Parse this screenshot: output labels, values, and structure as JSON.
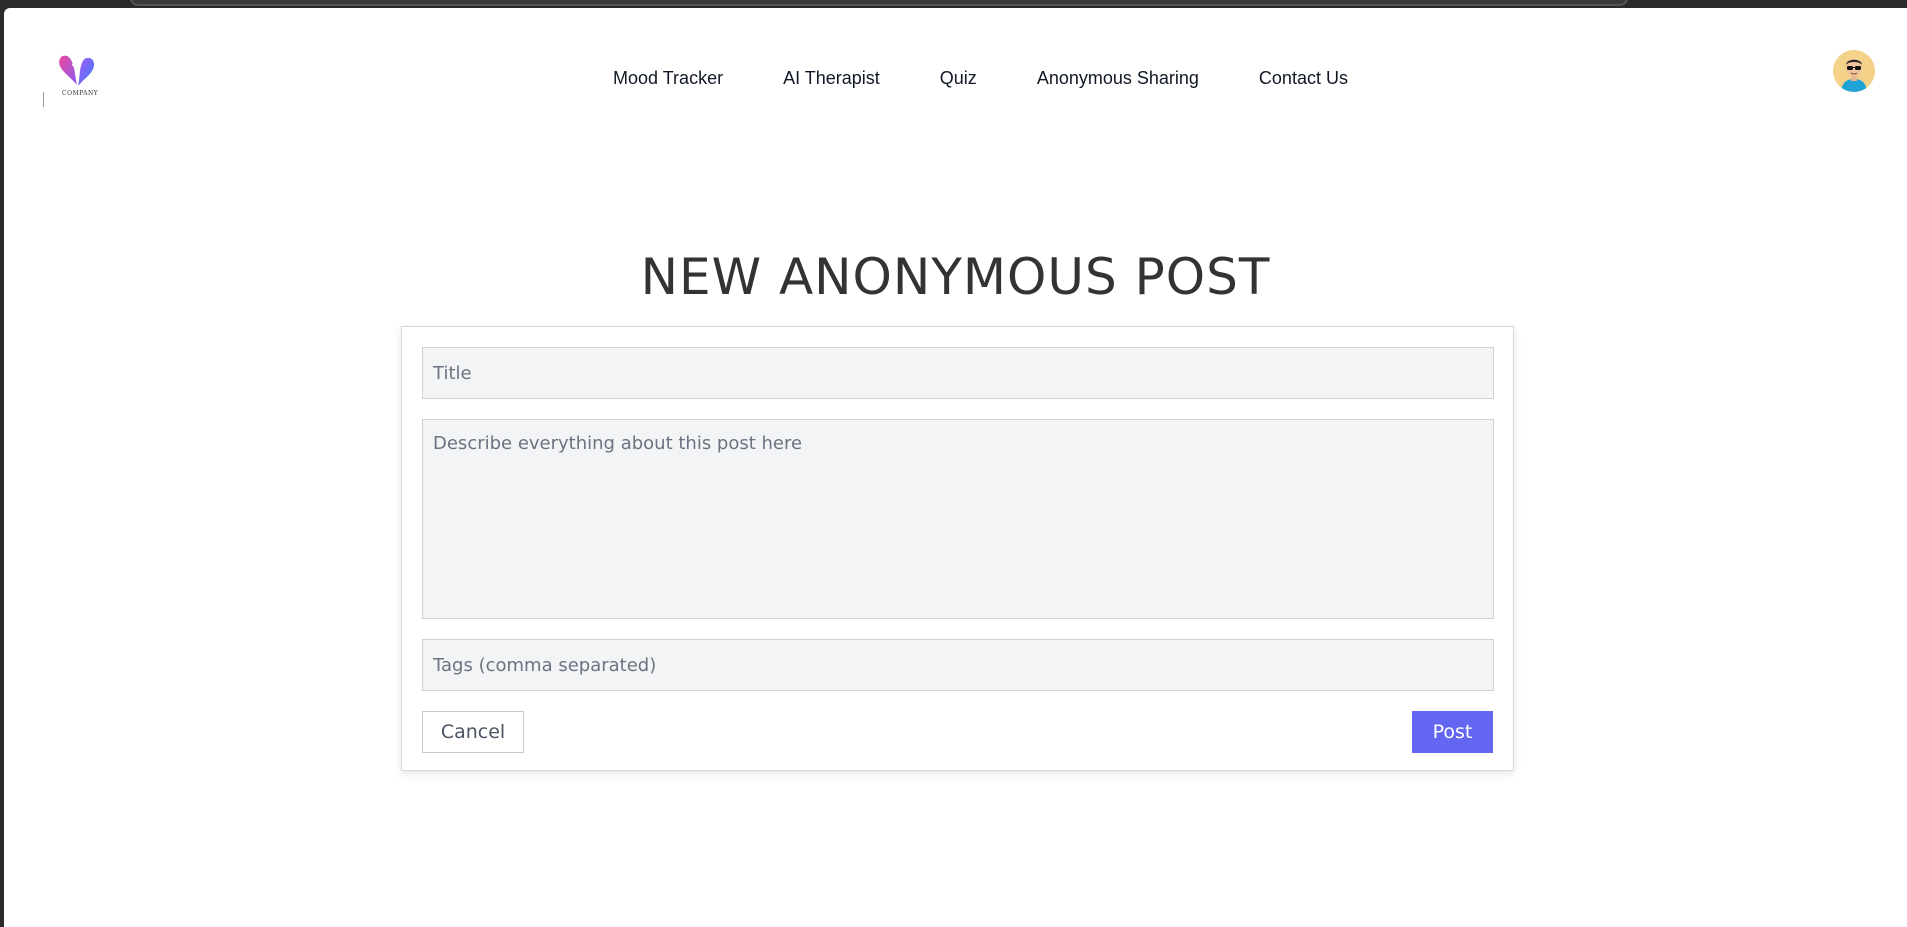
{
  "header": {
    "logo_caption": "COMPANY",
    "nav": [
      {
        "label": "Mood Tracker"
      },
      {
        "label": "AI Therapist"
      },
      {
        "label": "Quiz"
      },
      {
        "label": "Anonymous Sharing"
      },
      {
        "label": "Contact Us"
      }
    ],
    "avatar_icon": "user-avatar-sunglasses-icon"
  },
  "main": {
    "title": "NEW ANONYMOUS POST",
    "form": {
      "title_placeholder": "Title",
      "title_value": "",
      "description_placeholder": "Describe everything about this post here",
      "description_value": "",
      "tags_placeholder": "Tags (comma separated)",
      "tags_value": "",
      "cancel_label": "Cancel",
      "post_label": "Post"
    }
  },
  "colors": {
    "accent": "#6366f1",
    "input_bg": "#f3f4f6",
    "title_text": "#333333"
  }
}
